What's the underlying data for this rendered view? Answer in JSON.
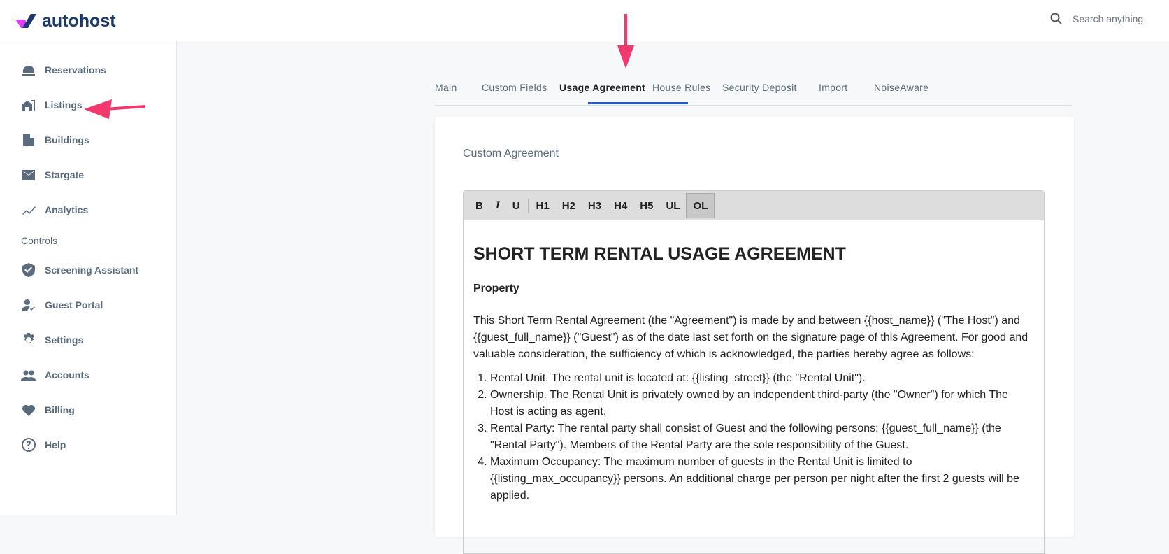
{
  "brand": {
    "name": "autohost"
  },
  "search": {
    "placeholder": "Search anything"
  },
  "sidebar": {
    "items": [
      {
        "label": "Reservations",
        "icon": "bell-icon"
      },
      {
        "label": "Listings",
        "icon": "building-icon"
      },
      {
        "label": "Buildings",
        "icon": "buildings-icon"
      },
      {
        "label": "Stargate",
        "icon": "mail-icon"
      },
      {
        "label": "Analytics",
        "icon": "chart-icon"
      }
    ],
    "section": "Controls",
    "controls": [
      {
        "label": "Screening Assistant",
        "icon": "shield-icon"
      },
      {
        "label": "Guest Portal",
        "icon": "user-check-icon"
      },
      {
        "label": "Settings",
        "icon": "gear-icon"
      },
      {
        "label": "Accounts",
        "icon": "people-icon"
      },
      {
        "label": "Billing",
        "icon": "heart-icon"
      },
      {
        "label": "Help",
        "icon": "help-icon"
      }
    ]
  },
  "tabs": [
    "Main",
    "Custom Fields",
    "Usage Agreement",
    "House Rules",
    "Security Deposit",
    "Import",
    "NoiseAware"
  ],
  "card": {
    "title": "Custom Agreement"
  },
  "toolbar": [
    "B",
    "I",
    "U",
    "H1",
    "H2",
    "H3",
    "H4",
    "H5",
    "UL",
    "OL"
  ],
  "doc": {
    "title": "SHORT TERM RENTAL USAGE AGREEMENT",
    "subtitle": "Property",
    "intro": "This Short Term Rental Agreement (the \"Agreement\") is made by and between {{host_name}} (\"The Host\") and {{guest_full_name}} (\"Guest\") as of the date last set forth on the signature page of this Agreement. For good and valuable consideration, the sufficiency of which is acknowledged, the parties hereby agree as follows:",
    "items": [
      "Rental Unit. The rental unit is located at: {{listing_street}} (the \"Rental Unit\").",
      "Ownership. The Rental Unit is privately owned by an independent third-party (the \"Owner\") for which The Host is acting as agent.",
      "Rental Party: The rental party shall consist of Guest and the following persons: {{guest_full_name}} (the \"Rental Party\"). Members of the Rental Party are the sole responsibility of the Guest.",
      "Maximum Occupancy: The maximum number of guests in the Rental Unit is limited to {{listing_max_occupancy}} persons. An additional charge per person per night after the first 2 guests will be applied."
    ]
  },
  "colors": {
    "accent": "#1e5bc6",
    "arrow": "#f2386d"
  }
}
